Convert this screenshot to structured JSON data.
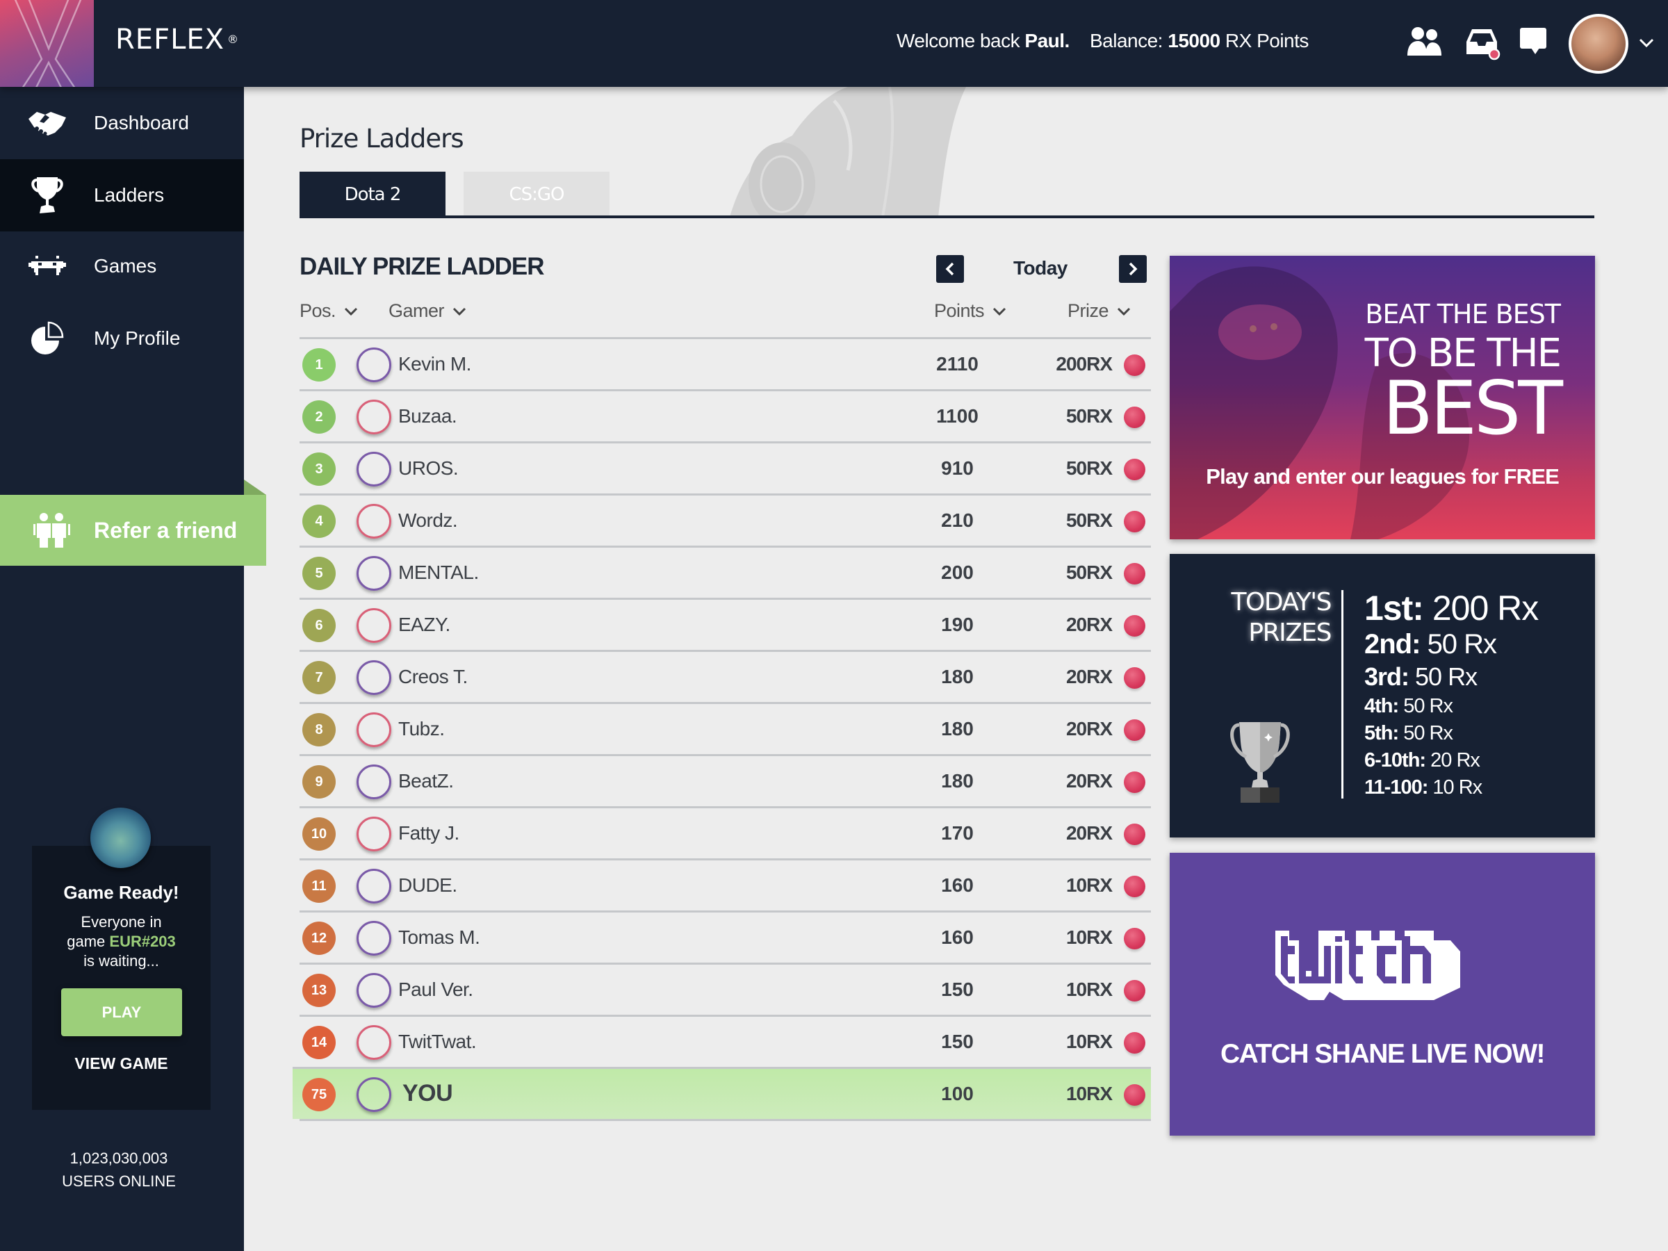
{
  "header": {
    "brand": "REFLEX",
    "brand_mark": "®",
    "welcome_prefix": "Welcome back",
    "user_name": "Paul.",
    "balance_label": "Balance:",
    "balance_value": "15000",
    "balance_unit": "RX Points",
    "icons": [
      "friends-icon",
      "inbox-icon",
      "chat-icon"
    ],
    "inbox_notification_color": "#e0506e"
  },
  "sidebar": {
    "items": [
      {
        "label": "Dashboard",
        "icon": "handshake-icon",
        "active": false
      },
      {
        "label": "Ladders",
        "icon": "trophy-icon",
        "active": true
      },
      {
        "label": "Games",
        "icon": "space-invader-icon",
        "active": false
      },
      {
        "label": "My Profile",
        "icon": "pie-chart-icon",
        "active": false
      }
    ],
    "refer": {
      "label": "Refer a friend",
      "icon": "people-icon"
    },
    "game_card": {
      "title": "Game Ready!",
      "line1": "Everyone in",
      "line2_prefix": "game",
      "game_code": "EUR#203",
      "line3": "is waiting...",
      "play_label": "PLAY",
      "view_label": "VIEW GAME"
    },
    "users_online_count": "1,023,030,003",
    "users_online_label": "USERS ONLINE"
  },
  "main": {
    "page_title": "Prize Ladders",
    "tabs": [
      {
        "label": "Dota 2",
        "active": true
      },
      {
        "label": "CS:GO",
        "active": false
      }
    ],
    "ladder": {
      "title": "DAILY PRIZE LADDER",
      "period": "Today",
      "columns": {
        "pos": "Pos.",
        "gamer": "Gamer",
        "points": "Points",
        "prize": "Prize"
      },
      "rows": [
        {
          "pos": "1",
          "gamer": "Kevin M.",
          "points": "2110",
          "prize": "200RX",
          "badge_color": "#8acc6a",
          "ring": "purple"
        },
        {
          "pos": "2",
          "gamer": "Buzaa.",
          "points": "1100",
          "prize": "50RX",
          "badge_color": "#87c366",
          "ring": "pink"
        },
        {
          "pos": "3",
          "gamer": "UROS.",
          "points": "910",
          "prize": "50RX",
          "badge_color": "#8bbe60",
          "ring": "purple"
        },
        {
          "pos": "4",
          "gamer": "Wordz.",
          "points": "210",
          "prize": "50RX",
          "badge_color": "#92b75c",
          "ring": "pink"
        },
        {
          "pos": "5",
          "gamer": "MENTAL.",
          "points": "200",
          "prize": "50RX",
          "badge_color": "#97ae57",
          "ring": "purple"
        },
        {
          "pos": "6",
          "gamer": "EAZY.",
          "points": "190",
          "prize": "20RX",
          "badge_color": "#9ea654",
          "ring": "pink"
        },
        {
          "pos": "7",
          "gamer": "Creos T.",
          "points": "180",
          "prize": "20RX",
          "badge_color": "#a69e52",
          "ring": "purple"
        },
        {
          "pos": "8",
          "gamer": "Tubz.",
          "points": "180",
          "prize": "20RX",
          "badge_color": "#b0954f",
          "ring": "pink"
        },
        {
          "pos": "9",
          "gamer": "BeatZ.",
          "points": "180",
          "prize": "20RX",
          "badge_color": "#b88c4c",
          "ring": "purple"
        },
        {
          "pos": "10",
          "gamer": "Fatty J.",
          "points": "170",
          "prize": "20RX",
          "badge_color": "#c18248",
          "ring": "pink"
        },
        {
          "pos": "11",
          "gamer": "DUDE.",
          "points": "160",
          "prize": "10RX",
          "badge_color": "#c97944",
          "ring": "purple"
        },
        {
          "pos": "12",
          "gamer": "Tomas M.",
          "points": "160",
          "prize": "10RX",
          "badge_color": "#d06f40",
          "ring": "purple"
        },
        {
          "pos": "13",
          "gamer": "Paul Ver.",
          "points": "150",
          "prize": "10RX",
          "badge_color": "#d8673c",
          "ring": "purple"
        },
        {
          "pos": "14",
          "gamer": "TwitTwat.",
          "points": "150",
          "prize": "10RX",
          "badge_color": "#de603a",
          "ring": "pink"
        }
      ],
      "you_row": {
        "pos": "75",
        "gamer": "YOU",
        "points": "100",
        "prize": "10RX",
        "badge_color": "#e36a42",
        "highlight_color": "#c4eaad"
      }
    }
  },
  "promo": {
    "line1": "BEAT THE BEST",
    "line2": "TO BE THE",
    "line3": "BEST",
    "subline": "Play and enter our leagues for FREE"
  },
  "prizes": {
    "title_line1": "TODAY'S",
    "title_line2": "PRIZES",
    "list": [
      {
        "place": "1st:",
        "amount": "200 Rx"
      },
      {
        "place": "2nd:",
        "amount": "50 Rx"
      },
      {
        "place": "3rd:",
        "amount": "50 Rx"
      },
      {
        "place": "4th:",
        "amount": "50 Rx"
      },
      {
        "place": "5th:",
        "amount": "50 Rx"
      },
      {
        "place": "6-10th:",
        "amount": "20 Rx"
      },
      {
        "place": "11-100:",
        "amount": "10 Rx"
      }
    ]
  },
  "twitch": {
    "logo_text": "twitch",
    "cta": "CATCH SHANE LIVE NOW!",
    "bg_color": "#5e459d"
  },
  "colors": {
    "navy": "#172133",
    "green": "#9ccf7a",
    "gem": "#d8385c"
  }
}
